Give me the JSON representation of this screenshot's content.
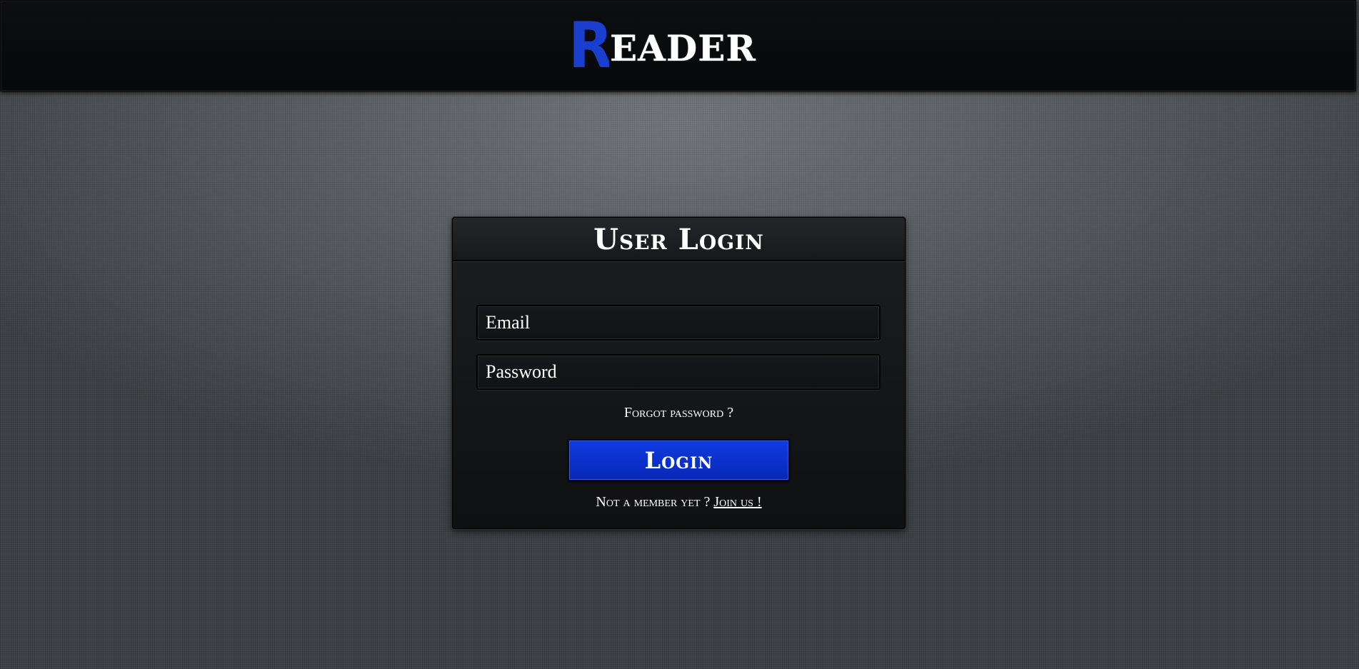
{
  "header": {
    "logo_initial": "R",
    "logo_rest": "EADER",
    "logo_initial_color": "#1a3fcf"
  },
  "login": {
    "title": "User Login",
    "email_placeholder": "Email",
    "password_placeholder": "Password",
    "forgot_label": "Forgot password ?",
    "submit_label": "Login",
    "not_member_label": "Not a member yet ?",
    "join_label": "Join us !",
    "button_color": "#0a32d0"
  }
}
